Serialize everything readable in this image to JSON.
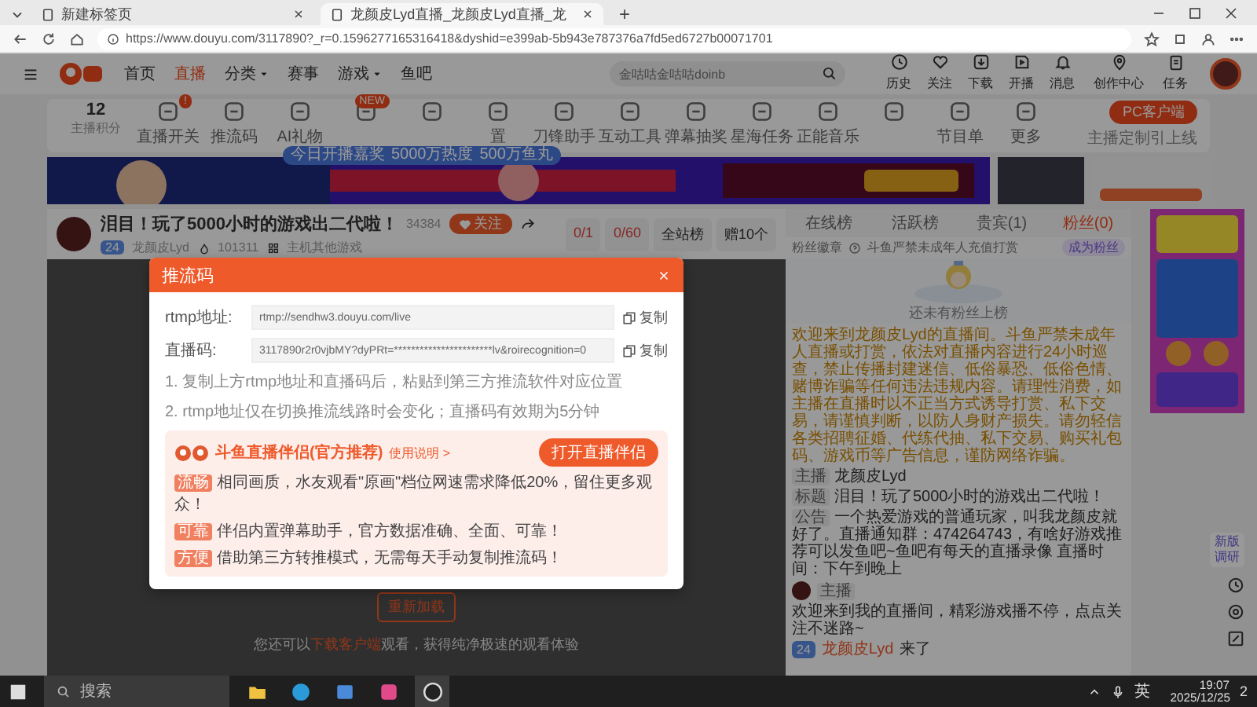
{
  "browser": {
    "tabs": [
      {
        "title": "新建标签页",
        "selected": false
      },
      {
        "title": "龙颜皮Lyd直播_龙颜皮Lyd直播_龙",
        "selected": true
      }
    ],
    "new_tab": "+",
    "url": "https://www.douyu.com/3117890?_r=0.1596277165316418&dyshid=e399ab-5b943e787376a7fd5ed6727b00071701"
  },
  "header": {
    "nav": [
      {
        "label": "首页",
        "selected": false,
        "dropdown": false
      },
      {
        "label": "直播",
        "selected": true,
        "dropdown": false
      },
      {
        "label": "分类",
        "selected": false,
        "dropdown": true
      },
      {
        "label": "赛事",
        "selected": false,
        "dropdown": false
      },
      {
        "label": "游戏",
        "selected": false,
        "dropdown": true
      },
      {
        "label": "鱼吧",
        "selected": false,
        "dropdown": false
      }
    ],
    "search": {
      "placeholder": "金咕咕金咕咕doinb"
    },
    "actions": [
      "历史",
      "关注",
      "下载",
      "开播",
      "消息",
      "创作中心",
      "任务"
    ]
  },
  "toolbar": {
    "score": "12",
    "score_label": "主播积分",
    "items": [
      {
        "kind": "tool",
        "label": "直播开关",
        "badge": "!"
      },
      {
        "kind": "tool",
        "label": "推流码"
      },
      {
        "kind": "tool",
        "label": "AI礼物"
      },
      {
        "kind": "tool",
        "badge": "NEW"
      },
      {
        "kind": "tool"
      },
      {
        "kind": "tool",
        "label": "置"
      },
      {
        "kind": "tool",
        "label": "刀锋助手"
      },
      {
        "kind": "tool",
        "label": "互动工具"
      },
      {
        "kind": "tool",
        "label": "弹幕抽奖"
      },
      {
        "kind": "tool",
        "label": "星海任务"
      },
      {
        "kind": "tool",
        "label": "正能音乐"
      },
      {
        "kind": "tool"
      },
      {
        "kind": "tool",
        "label": "节目单"
      },
      {
        "kind": "tool",
        "label": "更多"
      }
    ],
    "tooltip": [
      "今日开播嘉奖",
      "5000万热度",
      "500万鱼丸"
    ],
    "client_button": "PC客户端",
    "client_note": "主播定制引上线"
  },
  "streamer": {
    "title": "泪目！玩了5000小时的游戏出二代啦！",
    "heat": "34384",
    "follow": "关注",
    "level": "24",
    "name": "龙颜皮Lyd",
    "fans": "101311",
    "category": "主机其他游戏",
    "stats": [
      "0/1",
      "0/60",
      "全站榜",
      "赠10个"
    ]
  },
  "modal": {
    "title": "推流码",
    "rows": [
      {
        "label": "rtmp地址:",
        "value": "rtmp://sendhw3.douyu.com/live",
        "copy": "复制"
      },
      {
        "label": "直播码:",
        "value": "3117890r2r0vjbMY?dyPRt=***********************lv&roirecognition=0",
        "copy": "复制"
      }
    ],
    "notes": [
      "1. 复制上方rtmp地址和直播码后，粘贴到第三方推流软件对应位置",
      "2. rtmp地址仅在切换推流线路时会变化；直播码有效期为5分钟"
    ],
    "promo": {
      "title": "斗鱼直播伴侣(官方推荐)",
      "link": "使用说明 >",
      "button": "打开直播伴侣",
      "points": [
        {
          "tag": "流畅",
          "text": "相同画质，水友观看\"原画\"档位网速需求降低20%，留住更多观众！"
        },
        {
          "tag": "可靠",
          "text": "伴侣内置弹幕助手，官方数据准确、全面、可靠！"
        },
        {
          "tag": "方便",
          "text": "借助第三方转推模式，无需每天手动复制推流码！"
        }
      ]
    }
  },
  "video": {
    "reload": "重新加载",
    "hint_before": "您还可以",
    "hint_link": "下载客户端",
    "hint_after": "观看，获得纯净极速的观看体验"
  },
  "panel": {
    "tabs": [
      {
        "label": "在线榜",
        "selected": false
      },
      {
        "label": "活跃榜",
        "selected": false
      },
      {
        "label": "贵宾(1)",
        "selected": false
      },
      {
        "label": "粉丝(0)",
        "selected": true
      }
    ],
    "fan_label": "粉丝徽章",
    "fan_notice": "斗鱼严禁未成年人充值打赏",
    "fan_button": "成为粉丝",
    "empty": "还未有粉丝上榜",
    "notice": "欢迎来到龙颜皮Lyd的直播间。斗鱼严禁未成年人直播或打赏，依法对直播内容进行24小时巡查，禁止传播封建迷信、低俗暴恐、低俗色情、赌博诈骗等任何违法违规内容。请理性消费，如主播在直播时以不正当方式诱导打赏、私下交易，请谨慎判断，以防人身财产损失。请勿轻信各类招聘征婚、代练代抽、私下交易、购买礼包码、游戏币等广告信息，谨防网络诈骗。",
    "info": [
      {
        "tag": "主播",
        "text": "龙颜皮Lyd"
      },
      {
        "tag": "标题",
        "text": "泪目！玩了5000小时的游戏出二代啦！"
      },
      {
        "tag": "公告",
        "text": "一个热爱游戏的普通玩家，叫我龙颜皮就好了。直播通知群：474264743，有啥好游戏推荐可以发鱼吧~鱼吧有每天的直播录像 直播时间：下午到晚上"
      }
    ],
    "message": {
      "tag": "主播",
      "text": "欢迎来到我的直播间，精彩游戏播不停，点点关注不迷路~"
    },
    "enter": {
      "level": "24",
      "name": "龙颜皮Lyd",
      "text": "来了"
    }
  },
  "side": {
    "survey": "新版调研"
  },
  "taskbar": {
    "search": "搜索",
    "ime": "英",
    "time": "19:07",
    "date": "2025/12/25",
    "notifications": "2"
  }
}
